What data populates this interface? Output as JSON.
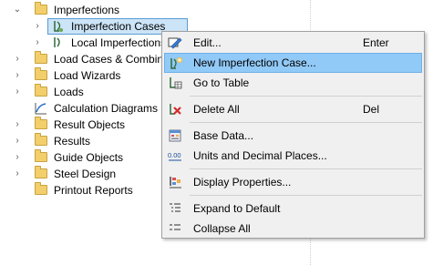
{
  "tree": {
    "root": {
      "label": "Imperfections"
    },
    "selected_item": {
      "label": "Imperfection Cases"
    },
    "child_item": {
      "label": "Local Imperfections"
    },
    "items": [
      {
        "label": "Load Cases & Combinations"
      },
      {
        "label": "Load Wizards"
      },
      {
        "label": "Loads"
      },
      {
        "label": "Calculation Diagrams"
      },
      {
        "label": "Result Objects"
      },
      {
        "label": "Results"
      },
      {
        "label": "Guide Objects"
      },
      {
        "label": "Steel Design"
      },
      {
        "label": "Printout Reports"
      }
    ]
  },
  "context_menu": {
    "items": [
      {
        "label": "Edit...",
        "shortcut": "Enter",
        "icon": "edit-icon"
      },
      {
        "label": "New Imperfection Case...",
        "shortcut": "",
        "icon": "new-imperfection-case-icon",
        "highlighted": true
      },
      {
        "label": "Go to Table",
        "shortcut": "",
        "icon": "table-icon"
      },
      {
        "label": "Delete All",
        "shortcut": "Del",
        "icon": "delete-icon"
      },
      {
        "label": "Base Data...",
        "shortcut": "",
        "icon": "base-data-icon"
      },
      {
        "label": "Units and Decimal Places...",
        "shortcut": "",
        "icon": "units-decimal-icon"
      },
      {
        "label": "Display Properties...",
        "shortcut": "",
        "icon": "display-properties-icon"
      },
      {
        "label": "Expand to Default",
        "shortcut": "",
        "icon": "expand-icon"
      },
      {
        "label": "Collapse All",
        "shortcut": "",
        "icon": "collapse-icon"
      }
    ],
    "units_icon_text": "0.00"
  },
  "colors": {
    "selection_bg": "#cce4f7",
    "menu_highlight": "#91c9f7",
    "folder": "#f2cf6b",
    "delete_red": "#d42b2b"
  }
}
